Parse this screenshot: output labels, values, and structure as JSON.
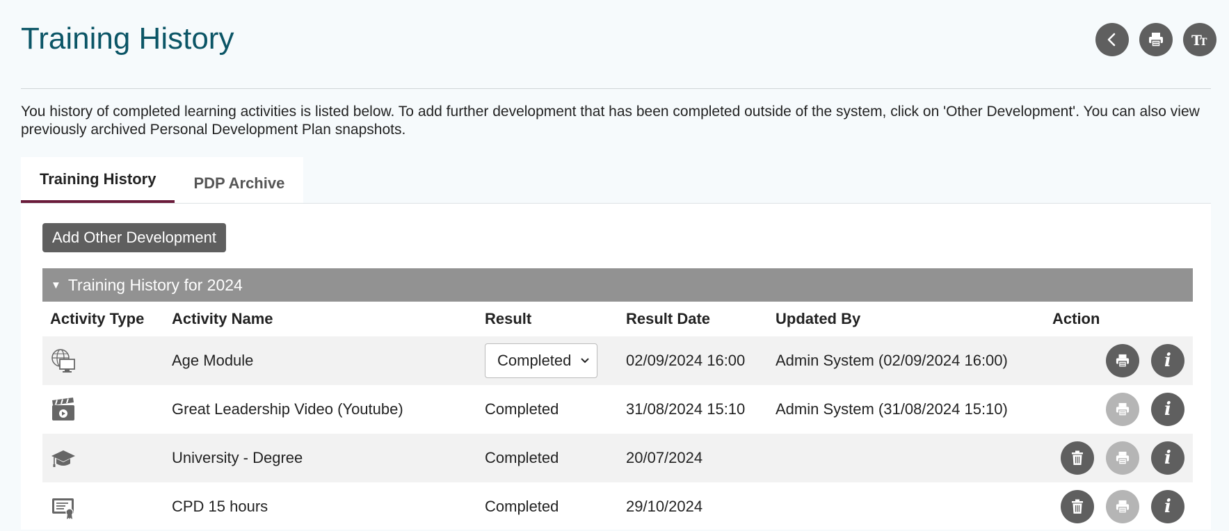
{
  "page": {
    "title": "Training History",
    "intro": "You history of completed learning activities is listed below. To add further development that has been completed outside of the system, click on 'Other Development'.  You can also view previously archived Personal Development Plan snapshots."
  },
  "header_actions": [
    {
      "icon": "back-icon"
    },
    {
      "icon": "print-icon"
    },
    {
      "icon": "text-size-icon"
    }
  ],
  "tabs": [
    {
      "label": "Training History",
      "active": true
    },
    {
      "label": "PDP Archive",
      "active": false
    }
  ],
  "add_button": {
    "label": "Add Other Development"
  },
  "section": {
    "label": "Training History for 2024",
    "expanded": true
  },
  "table": {
    "columns": [
      "Activity Type",
      "Activity Name",
      "Result",
      "Result Date",
      "Updated By",
      "Action"
    ],
    "rows": [
      {
        "type_icon": "e-learning-globe-icon",
        "name": "Age Module",
        "result": "Completed",
        "result_is_select": true,
        "date": "02/09/2024 16:00",
        "updated_by": "Admin System (02/09/2024 16:00)",
        "actions": [
          "print",
          "info"
        ]
      },
      {
        "type_icon": "video-clapperboard-icon",
        "name": "Great Leadership Video (Youtube)",
        "result": "Completed",
        "result_is_select": false,
        "date": "31/08/2024 15:10",
        "updated_by": "Admin System (31/08/2024 15:10)",
        "actions": [
          "print-disabled",
          "info"
        ]
      },
      {
        "type_icon": "graduation-cap-icon",
        "name": "University - Degree",
        "result": "Completed",
        "result_is_select": false,
        "date": "20/07/2024",
        "updated_by": "",
        "actions": [
          "delete",
          "print-disabled",
          "info"
        ]
      },
      {
        "type_icon": "certificate-icon",
        "name": "CPD 15 hours",
        "result": "Completed",
        "result_is_select": false,
        "date": "29/10/2024",
        "updated_by": "",
        "actions": [
          "delete",
          "print-disabled",
          "info"
        ]
      }
    ]
  },
  "colors": {
    "title": "#0b5566",
    "tab_active_underline": "#6a1b3a",
    "button_dark": "#5f5f5f",
    "button_disabled": "#b5b5b5",
    "section_bar": "#929292"
  }
}
